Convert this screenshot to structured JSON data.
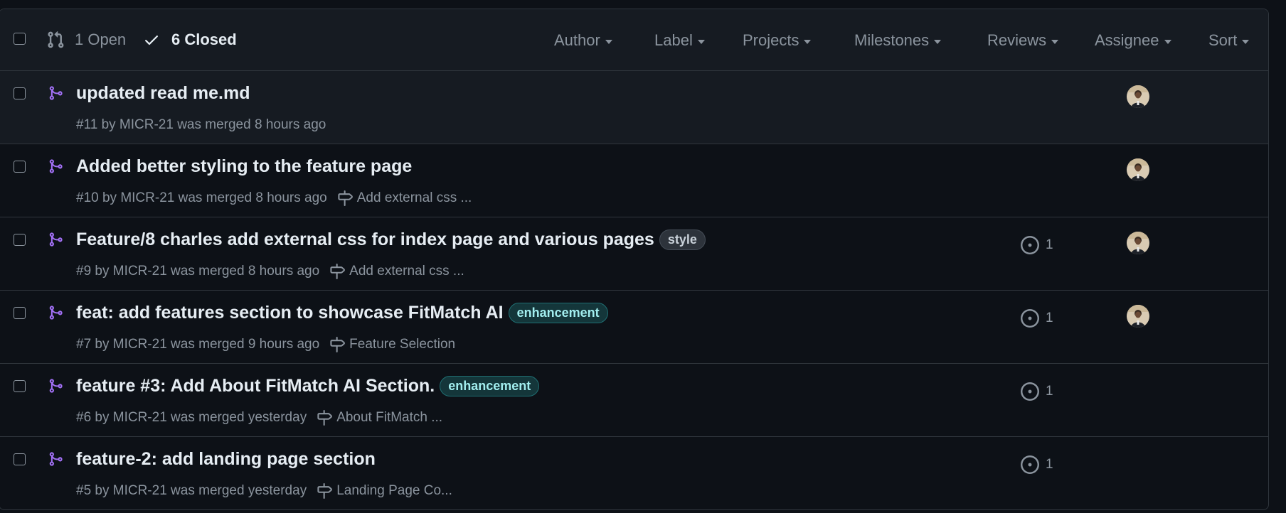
{
  "header": {
    "open_label": "1 Open",
    "closed_label": "6 Closed",
    "filters": [
      "Author",
      "Label",
      "Projects",
      "Milestones",
      "Reviews",
      "Assignee",
      "Sort"
    ]
  },
  "prs": [
    {
      "title": "updated read me.md",
      "meta": "#11 by MICR-21 was merged 8 hours ago",
      "milestone": "",
      "label": "",
      "issues": "",
      "avatar": true
    },
    {
      "title": "Added better styling to the feature page",
      "meta": "#10 by MICR-21 was merged 8 hours ago",
      "milestone": "Add external css ...",
      "label": "",
      "issues": "",
      "avatar": true
    },
    {
      "title": "Feature/8 charles add external css for index page and various pages",
      "meta": "#9 by MICR-21 was merged 8 hours ago",
      "milestone": "Add external css ...",
      "label": "style",
      "issues": "1",
      "avatar": true
    },
    {
      "title": "feat: add features section to showcase FitMatch AI",
      "meta": "#7 by MICR-21 was merged 9 hours ago",
      "milestone": "Feature Selection",
      "label": "enhancement",
      "issues": "1",
      "avatar": true
    },
    {
      "title": "feature #3: Add About FitMatch AI Section.",
      "meta": "#6 by MICR-21 was merged yesterday",
      "milestone": "About FitMatch ...",
      "label": "enhancement",
      "issues": "1",
      "avatar": false
    },
    {
      "title": "feature-2: add landing page section",
      "meta": "#5 by MICR-21 was merged yesterday",
      "milestone": "Landing Page Co...",
      "label": "",
      "issues": "1",
      "avatar": false
    }
  ],
  "colors": {
    "merged": "#a371f7",
    "background": "#0d1117",
    "header_bg": "#161b22",
    "border": "#30363d",
    "muted": "#8b949e"
  }
}
